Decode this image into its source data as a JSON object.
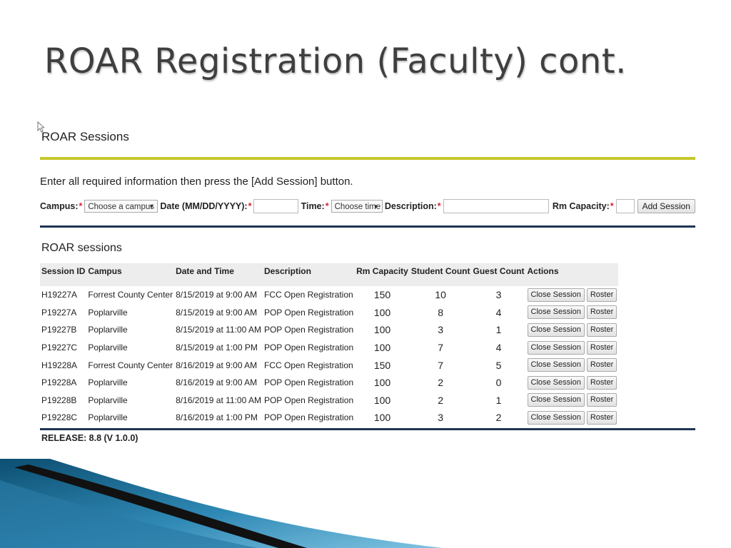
{
  "slide": {
    "title": "ROAR Registration (Faculty) cont."
  },
  "panel": {
    "heading": "ROAR Sessions",
    "instructions": "Enter all required information then press the [Add Session] button.",
    "form": {
      "campus_label": "Campus:",
      "campus_value": "Choose a campus",
      "date_label": "Date (MM/DD/YYYY):",
      "date_value": "",
      "time_label": "Time:",
      "time_value": "Choose time",
      "description_label": "Description:",
      "description_value": "",
      "capacity_label": "Rm Capacity:",
      "capacity_value": "",
      "required_mark": "*",
      "add_button": "Add Session"
    },
    "sessions_heading": "ROAR sessions",
    "columns": [
      "Session ID",
      "Campus",
      "Date and Time",
      "Description",
      "Rm Capacity",
      "Student Count",
      "Guest Count",
      "Actions"
    ],
    "rows": [
      {
        "id": "H19227A",
        "campus": "Forrest County Center",
        "datetime": "8/15/2019 at 9:00 AM",
        "description": "FCC Open Registration",
        "capacity": "150",
        "students": "10",
        "guests": "3"
      },
      {
        "id": "P19227A",
        "campus": "Poplarville",
        "datetime": "8/15/2019 at 9:00 AM",
        "description": "POP Open Registration",
        "capacity": "100",
        "students": "8",
        "guests": "4"
      },
      {
        "id": "P19227B",
        "campus": "Poplarville",
        "datetime": "8/15/2019 at 11:00 AM",
        "description": "POP Open Registration",
        "capacity": "100",
        "students": "3",
        "guests": "1"
      },
      {
        "id": "P19227C",
        "campus": "Poplarville",
        "datetime": "8/15/2019 at 1:00 PM",
        "description": "POP Open Registration",
        "capacity": "100",
        "students": "7",
        "guests": "4"
      },
      {
        "id": "H19228A",
        "campus": "Forrest County Center",
        "datetime": "8/16/2019 at 9:00 AM",
        "description": "FCC Open Registration",
        "capacity": "150",
        "students": "7",
        "guests": "5"
      },
      {
        "id": "P19228A",
        "campus": "Poplarville",
        "datetime": "8/16/2019 at 9:00 AM",
        "description": "POP Open Registration",
        "capacity": "100",
        "students": "2",
        "guests": "0"
      },
      {
        "id": "P19228B",
        "campus": "Poplarville",
        "datetime": "8/16/2019 at 11:00 AM",
        "description": "POP Open Registration",
        "capacity": "100",
        "students": "2",
        "guests": "1"
      },
      {
        "id": "P19228C",
        "campus": "Poplarville",
        "datetime": "8/16/2019 at 1:00 PM",
        "description": "POP Open Registration",
        "capacity": "100",
        "students": "3",
        "guests": "2"
      }
    ],
    "actions": {
      "close": "Close Session",
      "roster": "Roster"
    },
    "release": "RELEASE: 8.8 (V 1.0.0)"
  },
  "colors": {
    "accent_yellow": "#c6c82b",
    "rule_navy": "#1e3552",
    "required": "#dd2233"
  }
}
